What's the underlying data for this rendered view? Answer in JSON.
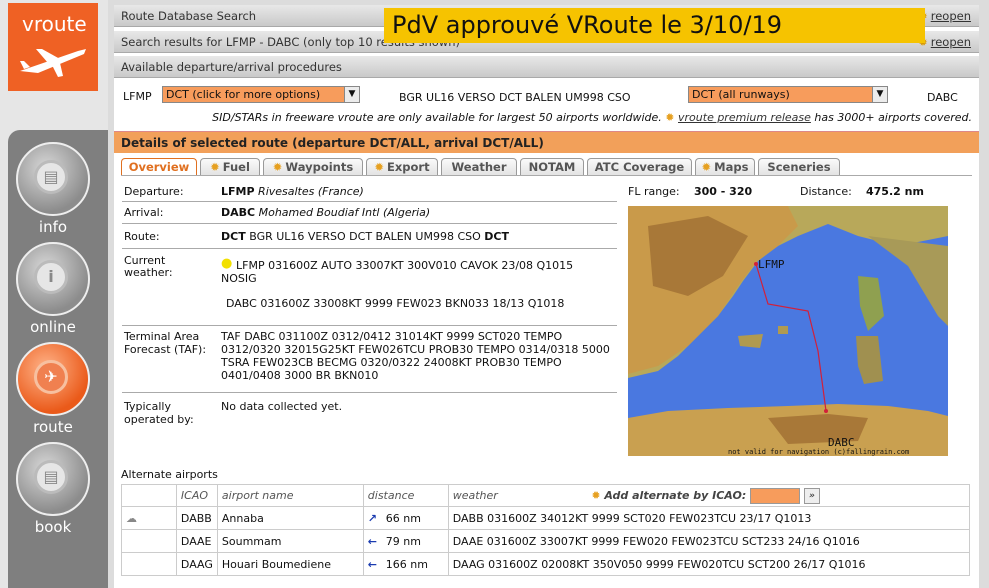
{
  "sidebar": {
    "logo": "vroute",
    "items": [
      {
        "label": "info",
        "glyph": "▤"
      },
      {
        "label": "online",
        "glyph": "i"
      },
      {
        "label": "route",
        "glyph": "✈"
      },
      {
        "label": "book",
        "glyph": "▤"
      }
    ]
  },
  "header": {
    "db_search": "Route Database Search",
    "results": "Search results for LFMP - DABC (only top 10 results shown)",
    "procedures": "Available departure/arrival procedures",
    "reopen": "reopen",
    "overlay": "PdV approuvé VRoute le 3/10/19"
  },
  "procedures": {
    "dep_icao": "LFMP",
    "dep_select": "DCT (click for more options)",
    "route_text": "BGR UL16 VERSO DCT BALEN UM998 CSO",
    "arr_select": "DCT (all runways)",
    "arr_icao": "DABC"
  },
  "notice": {
    "text1": "SID/STARs in freeware vroute are only available for largest 50 airports worldwide.",
    "link": "vroute premium release",
    "text2": "has 3000+ airports covered."
  },
  "details_title": "Details of selected route (departure DCT/ALL, arrival DCT/ALL)",
  "tabs": [
    "Overview",
    "Fuel",
    "Waypoints",
    "Export",
    "Weather",
    "NOTAM",
    "ATC Coverage",
    "Maps",
    "Sceneries"
  ],
  "overview": {
    "departure_label": "Departure:",
    "departure_icao": "LFMP",
    "departure_name": "Rivesaltes (France)",
    "fl_label": "FL range:",
    "fl_value": "300 - 320",
    "distance_label": "Distance:",
    "distance_value": "475.2 nm",
    "arrival_label": "Arrival:",
    "arrival_icao": "DABC",
    "arrival_name": "Mohamed Boudiaf Intl (Algeria)",
    "route_label": "Route:",
    "route_start": "DCT",
    "route_mid": "BGR UL16 VERSO DCT BALEN UM998 CSO",
    "route_end": "DCT",
    "weather_label1": "Current",
    "weather_label2": "weather:",
    "metar_dep1": "LFMP 031600Z AUTO 33007KT 300V010 CAVOK 23/08 Q1015",
    "metar_dep2": "NOSIG",
    "metar_arr": "DABC 031600Z 33008KT 9999 FEW023 BKN033 18/13 Q1018",
    "taf_label1": "Terminal Area",
    "taf_label2": "Forecast (TAF):",
    "taf1": "TAF DABC 031100Z 0312/0412 31014KT 9999 SCT020 TEMPO",
    "taf2": "0312/0320 32015G25KT FEW026TCU PROB30 TEMPO 0314/0318 5000",
    "taf3": "TSRA FEW023CB BECMG 0320/0322 24008KT PROB30 TEMPO",
    "taf4": "0401/0408 3000 BR BKN010",
    "ops_label1": "Typically",
    "ops_label2": "operated by:",
    "ops_value": "No data collected yet.",
    "map_dep": "LFMP",
    "map_arr": "DABC",
    "map_note": "not valid for navigation  (c)fallingrain.com"
  },
  "alternates": {
    "title": "Alternate airports",
    "headers": [
      "ICAO",
      "airport name",
      "distance",
      "weather"
    ],
    "add_label": "Add alternate by ICAO:",
    "go": "»",
    "rows": [
      {
        "icao": "DABB",
        "name": "Annaba",
        "dir": "↗",
        "dist": "66 nm",
        "wx": "DABB 031600Z 34012KT 9999 SCT020 FEW023TCU 23/17 Q1013"
      },
      {
        "icao": "DAAE",
        "name": "Soummam",
        "dir": "←",
        "dist": "79 nm",
        "wx": "DAAE 031600Z 33007KT 9999 FEW020 FEW023TCU SCT233 24/16 Q1016"
      },
      {
        "icao": "DAAG",
        "name": "Houari Boumediene",
        "dir": "←",
        "dist": "166 nm",
        "wx": "DAAG 031600Z 02008KT 350V050 9999 FEW020TCU SCT200 26/17 Q1016"
      }
    ]
  }
}
